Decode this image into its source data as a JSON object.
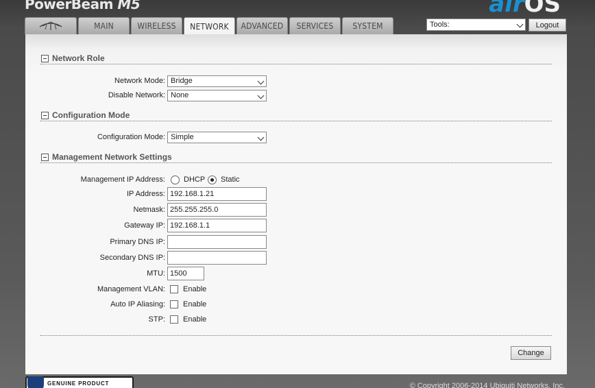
{
  "header": {
    "brand": "PowerBeam",
    "model": "M5",
    "product_air": "air",
    "product_os": "OS"
  },
  "tabs": [
    {
      "label": "",
      "icon": "ubiquiti-logo-icon"
    },
    {
      "label": "MAIN"
    },
    {
      "label": "WIRELESS"
    },
    {
      "label": "NETWORK",
      "active": true
    },
    {
      "label": "ADVANCED"
    },
    {
      "label": "SERVICES"
    },
    {
      "label": "SYSTEM"
    }
  ],
  "toolbar": {
    "tools_value": "Tools:",
    "logout_label": "Logout"
  },
  "network_role": {
    "title": "Network Role",
    "network_mode_label": "Network Mode:",
    "network_mode_value": "Bridge",
    "disable_network_label": "Disable Network:",
    "disable_network_value": "None"
  },
  "configuration_mode": {
    "title": "Configuration Mode",
    "label": "Configuration Mode:",
    "value": "Simple"
  },
  "management": {
    "title": "Management Network Settings",
    "ip_address_mode_label": "Management IP Address:",
    "dhcp_label": "DHCP",
    "static_label": "Static",
    "selected_mode": "Static",
    "ip_label": "IP Address:",
    "ip_value": "192.168.1.21",
    "netmask_label": "Netmask:",
    "netmask_value": "255.255.255.0",
    "gateway_label": "Gateway IP:",
    "gateway_value": "192.168.1.1",
    "primary_dns_label": "Primary DNS IP:",
    "primary_dns_value": "",
    "secondary_dns_label": "Secondary DNS IP:",
    "secondary_dns_value": "",
    "mtu_label": "MTU:",
    "mtu_value": "1500",
    "vlan_label": "Management VLAN:",
    "vlan_enable": "Enable",
    "alias_label": "Auto IP Aliasing:",
    "alias_enable": "Enable",
    "stp_label": "STP:",
    "stp_enable": "Enable"
  },
  "actions": {
    "change_label": "Change"
  },
  "footer": {
    "badge_text": "GENUINE   PRODUCT",
    "copyright": "© Copyright 2006-2014 Ubiquiti Networks, Inc."
  },
  "colors": {
    "accent_blue": "#1b8fd0",
    "panel_bg": "#f7f7f7",
    "tab_inactive": "#b8b8b8"
  }
}
